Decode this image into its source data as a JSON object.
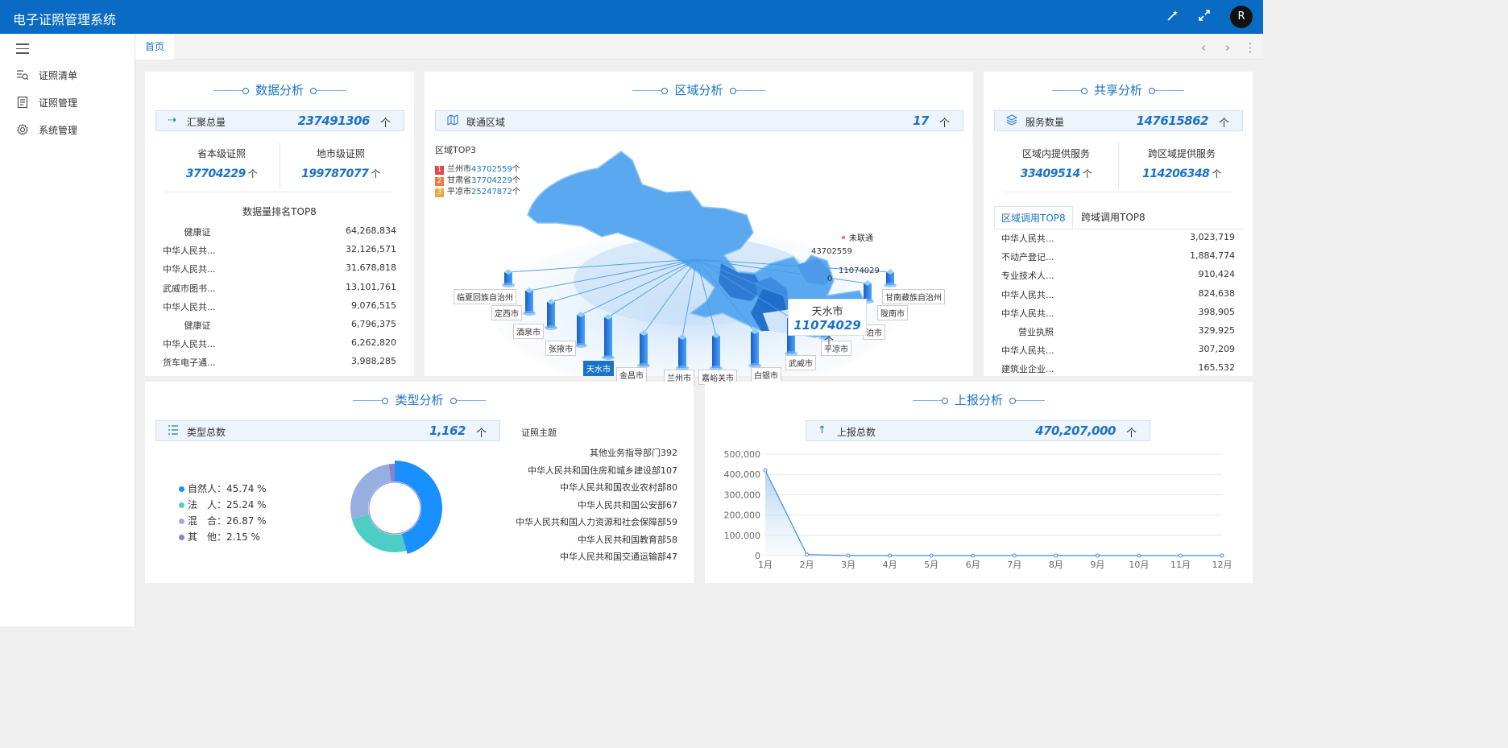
{
  "app": {
    "title": "电子证照管理系统",
    "avatar": "R"
  },
  "sidebar": {
    "items": [
      {
        "label": "证照清单",
        "icon": "list-search-icon"
      },
      {
        "label": "证照管理",
        "icon": "document-icon"
      },
      {
        "label": "系统管理",
        "icon": "gear-icon"
      }
    ]
  },
  "tabs": {
    "home": "首页"
  },
  "data_analysis": {
    "title": "数据分析",
    "summary_label": "汇聚总量",
    "summary_value": "237491306",
    "provincial_label": "省本级证照",
    "provincial_value": "37704229",
    "municipal_label": "地市级证照",
    "municipal_value": "199787077",
    "rank_title": "数据量排名TOP8",
    "rank": [
      {
        "name": "健康证",
        "value": "64,268,834"
      },
      {
        "name": "中华人民共...",
        "value": "32,126,571"
      },
      {
        "name": "中华人民共...",
        "value": "31,678,818"
      },
      {
        "name": "武威市图书...",
        "value": "13,101,761"
      },
      {
        "name": "中华人民共...",
        "value": "9,076,515"
      },
      {
        "name": "健康证",
        "value": "6,796,375"
      },
      {
        "name": "中华人民共...",
        "value": "6,262,820"
      },
      {
        "name": "货车电子通...",
        "value": "3,988,285"
      }
    ]
  },
  "region_analysis": {
    "title": "区域分析",
    "summary_label": "联通区域",
    "summary_value": "17",
    "top3_title": "区域TOP3",
    "top3": [
      {
        "rank": "1",
        "name": "兰州市",
        "value": "43702559",
        "unit": "个",
        "color": "#e0454a"
      },
      {
        "rank": "2",
        "name": "甘肃省",
        "value": "37704229",
        "unit": "个",
        "color": "#ef7b3a"
      },
      {
        "rank": "3",
        "name": "平凉市",
        "value": "25247872",
        "unit": "个",
        "color": "#f2a53c"
      }
    ],
    "unconnected_label": "未联通",
    "map_values": [
      "43702559",
      "11074029",
      "0"
    ],
    "tooltip": {
      "city": "天水市",
      "value": "11074029"
    },
    "cities": [
      "临夏回族自治州",
      "定西市",
      "酒泉市",
      "张掖市",
      "天水市",
      "金昌市",
      "兰州市",
      "嘉峪关市",
      "白银市",
      "武威市",
      "平凉市",
      "泊市",
      "陇南市",
      "甘南藏族自治州"
    ]
  },
  "share_analysis": {
    "title": "共享分析",
    "summary_label": "服务数量",
    "summary_value": "147615862",
    "inner_label": "区域内提供服务",
    "inner_value": "33409514",
    "cross_label": "跨区域提供服务",
    "cross_value": "114206348",
    "tab_inner": "区域调用TOP8",
    "tab_cross": "跨域调用TOP8",
    "rank": [
      {
        "name": "中华人民共...",
        "value": "3,023,719"
      },
      {
        "name": "不动产登记...",
        "value": "1,884,774"
      },
      {
        "name": "专业技术人...",
        "value": "910,424"
      },
      {
        "name": "中华人民共...",
        "value": "824,638"
      },
      {
        "name": "中华人民共...",
        "value": "398,905"
      },
      {
        "name": "营业执照",
        "value": "329,925"
      },
      {
        "name": "中华人民共...",
        "value": "307,209"
      },
      {
        "name": "建筑业企业...",
        "value": "165,532"
      }
    ]
  },
  "type_analysis": {
    "title": "类型分析",
    "summary_label": "类型总数",
    "summary_value": "1,162",
    "legend": [
      {
        "label": "自然人：45.74 %",
        "value": 45.74,
        "color": "#1890ff"
      },
      {
        "label": "法　人：25.24 %",
        "value": 25.24,
        "color": "#4ecdc4"
      },
      {
        "label": "混　合：26.87 %",
        "value": 26.87,
        "color": "#96aee0"
      },
      {
        "label": "其　他：2.15 %",
        "value": 2.15,
        "color": "#8c7fd0"
      }
    ],
    "subject_title": "证照主题",
    "subjects": [
      {
        "name": "其他业务指导部门",
        "value": "392"
      },
      {
        "name": "中华人民共和国住房和城乡建设部",
        "value": "107"
      },
      {
        "name": "中华人民共和国农业农村部",
        "value": "80"
      },
      {
        "name": "中华人民共和国公安部",
        "value": "67"
      },
      {
        "name": "中华人民共和国人力资源和社会保障部",
        "value": "59"
      },
      {
        "name": "中华人民共和国教育部",
        "value": "58"
      },
      {
        "name": "中华人民共和国交通运输部",
        "value": "47"
      }
    ]
  },
  "report_analysis": {
    "title": "上报分析",
    "summary_label": "上报总数",
    "summary_value": "470,207,000"
  },
  "arrow": "个",
  "chart_data": {
    "type": "line",
    "x": [
      "1月",
      "2月",
      "3月",
      "4月",
      "5月",
      "6月",
      "7月",
      "8月",
      "9月",
      "10月",
      "11月",
      "12月"
    ],
    "series": [
      {
        "values": [
          420000,
          5000,
          0,
          0,
          0,
          0,
          0,
          0,
          0,
          0,
          0,
          0
        ]
      }
    ],
    "yticks": [
      "500,000",
      "400,000",
      "300,000",
      "200,000",
      "100,000",
      "0"
    ],
    "ylim": [
      0,
      500000
    ],
    "grid": true,
    "color": "#3a8fd9"
  }
}
